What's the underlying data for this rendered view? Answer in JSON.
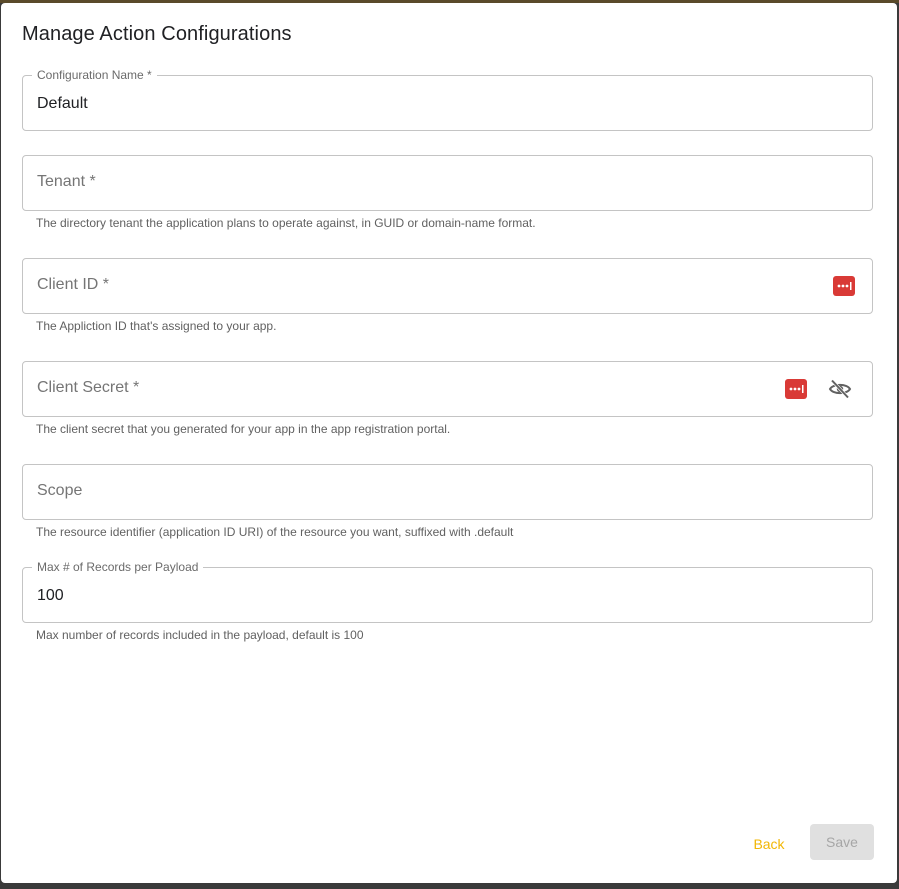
{
  "dialog": {
    "title": "Manage Action Configurations"
  },
  "fields": {
    "configuration_name": {
      "label": "Configuration Name *",
      "value": "Default"
    },
    "tenant": {
      "placeholder": "Tenant *",
      "helper": "The directory tenant the application plans to operate against, in GUID or domain-name format."
    },
    "client_id": {
      "placeholder": "Client ID *",
      "helper": "The Appliction ID that's assigned to your app."
    },
    "client_secret": {
      "placeholder": "Client Secret *",
      "helper": "The client secret that you generated for your app in the app registration portal."
    },
    "scope": {
      "placeholder": "Scope",
      "helper": "The resource identifier (application ID URI) of the resource you want, suffixed with .default"
    },
    "max_records": {
      "label": "Max # of Records per Payload",
      "value": "100",
      "helper": "Max number of records included in the payload, default is 100"
    }
  },
  "actions": {
    "back_label": "Back",
    "save_label": "Save"
  },
  "icons": {
    "password_manager": "password-manager-icon",
    "visibility_off": "eye-off-icon"
  },
  "colors": {
    "accent": "#f2b705",
    "password_icon": "#d93a36",
    "disabled_bg": "#e0e0e0"
  }
}
